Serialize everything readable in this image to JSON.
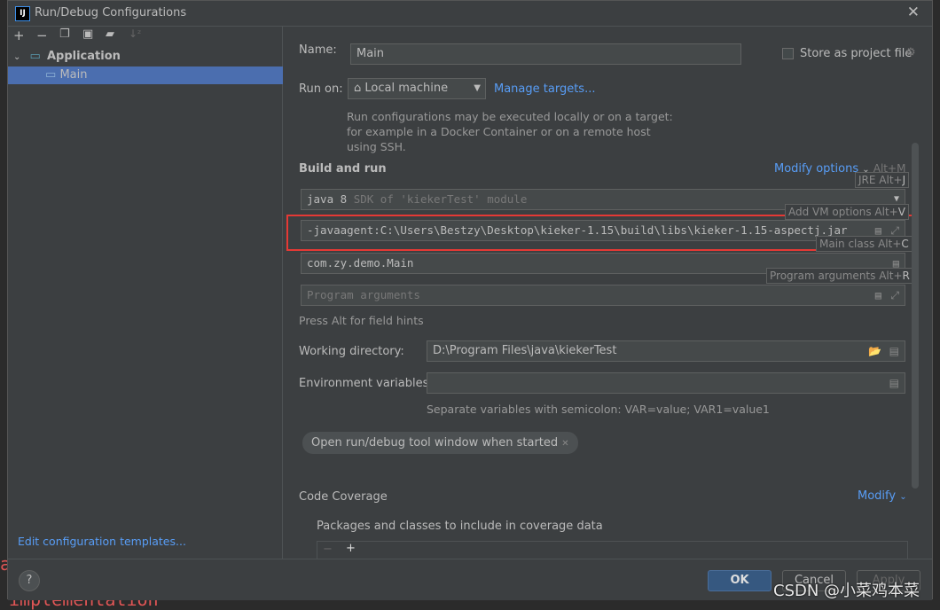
{
  "window": {
    "title": "Run/Debug Configurations",
    "logo": "IJ"
  },
  "toolbar": {
    "icons": [
      "plus-icon",
      "minus-icon",
      "copy-icon",
      "save-icon",
      "folder-add-icon",
      "sort-icon"
    ]
  },
  "tree": {
    "group": "Application",
    "item": "Main"
  },
  "left_footer": {
    "templates_link": "Edit configuration templates..."
  },
  "form": {
    "name_label": "Name:",
    "name_value": "Main",
    "store_label": "Store as project file",
    "run_on_label": "Run on:",
    "run_on_value": "Local machine",
    "manage_targets": "Manage targets...",
    "run_on_hint": "Run configurations may be executed locally or on a target: for example in a Docker Container or on a remote host using SSH.",
    "build_run": "Build and run",
    "modify_options": "Modify options",
    "modify_shortcut": "Alt+M",
    "jre_value": "java 8",
    "jre_hint": "SDK of 'kiekerTest' module",
    "vm_options": "-javaagent:C:\\Users\\Bestzy\\Desktop\\kieker-1.15\\build\\libs\\kieker-1.15-aspectj.jar",
    "main_class": "com.zy.demo.Main",
    "program_args_placeholder": "Program arguments",
    "field_hints": "Press Alt for field hints",
    "working_dir_label": "Working directory:",
    "working_dir_value": "D:\\Program Files\\java\\kiekerTest",
    "env_label": "Environment variables:",
    "env_value": "",
    "env_hint": "Separate variables with semicolon: VAR=value; VAR1=value1",
    "open_tool_window": "Open run/debug tool window when started",
    "code_coverage": "Code Coverage",
    "modify": "Modify",
    "packages_label": "Packages and classes to include in coverage data"
  },
  "tooltips": {
    "jre": "JRE Alt+",
    "jre_key": "J",
    "vm": "Add VM options Alt+",
    "vm_key": "V",
    "main": "Main class Alt+",
    "main_key": "C",
    "args": "Program arguments Alt+",
    "args_key": "R"
  },
  "footer": {
    "ok": "OK",
    "cancel": "Cancel",
    "apply": "Apply",
    "help": "?"
  },
  "watermark": "CSDN @小菜鸡本菜",
  "background_code": [
    "a",
    "implementation"
  ],
  "colors": {
    "accent": "#589df6",
    "selection": "#4b6eaf",
    "highlight_box": "#e53935",
    "ok_button": "#365880"
  }
}
